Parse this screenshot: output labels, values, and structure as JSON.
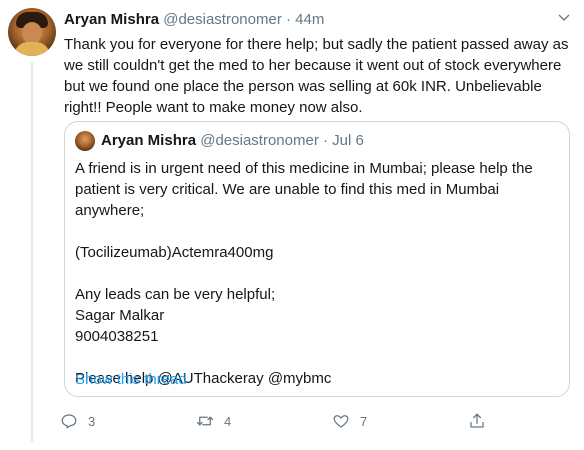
{
  "tweet": {
    "author_name": "Aryan Mishra",
    "author_handle": "@desiastronomer",
    "separator": "·",
    "time": "44m",
    "text": "Thank you for everyone for there help; but sadly the patient passed away as we still couldn't get the med to her because it went out of stock everywhere but we found one place the person was selling at 60k INR. Unbelievable right!! People want to make money now also."
  },
  "quoted": {
    "author_name": "Aryan Mishra",
    "author_handle": "@desiastronomer",
    "separator": "·",
    "time": "Jul 6",
    "paragraphs": [
      "A friend is in urgent need of this medicine in Mumbai; please help the patient is very critical. We are unable to find this med in Mumbai anywhere;",
      "(Tocilizeumab)Actemra400mg",
      "Any leads can be very helpful;",
      "Sagar Malkar",
      "9004038251",
      "Please help @AUThackeray @mybmc"
    ],
    "show_thread": "Show this thread"
  },
  "actions": {
    "reply_count": "3",
    "retweet_count": "4",
    "like_count": "7",
    "icons": [
      "reply-icon",
      "retweet-icon",
      "like-icon",
      "share-icon"
    ],
    "icon_color": "#657786"
  },
  "colors": {
    "link": "#1da1f2",
    "muted": "#657786",
    "border": "#ccd6dd"
  }
}
